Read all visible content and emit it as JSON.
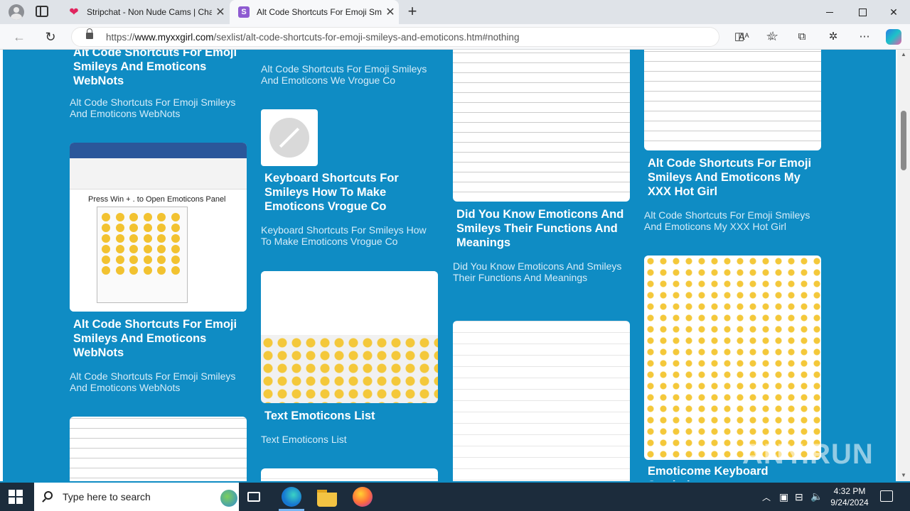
{
  "browser": {
    "tabs": [
      {
        "title": "Stripchat - Non Nude Cams | Cha",
        "active": false
      },
      {
        "title": "Alt Code Shortcuts For Emoji Sm",
        "active": true
      }
    ],
    "url_prefix": "https://",
    "url_domain": "www.myxxgirl.com",
    "url_path": "/sexlist/alt-code-shortcuts-for-emoji-smileys-and-emoticons.htm#nothing",
    "read_aloud_label": "Aᴬ"
  },
  "cards": {
    "c1_top": {
      "title": "Alt Code Shortcuts For Emoji Smileys And Emoticons WebNots",
      "subtitle": "Alt Code Shortcuts For Emoji Smileys And Emoticons WebNots"
    },
    "c1_word": {
      "caption": "Press Win + . to Open Emoticons Panel",
      "title": "Alt Code Shortcuts For Emoji Smileys And Emoticons WebNots",
      "subtitle": "Alt Code Shortcuts For Emoji Smileys And Emoticons WebNots"
    },
    "c2_top": {
      "subtitle": "Alt Code Shortcuts For Emoji Smileys And Emoticons We Vrogue Co"
    },
    "c2_kbd": {
      "title": "Keyboard Shortcuts For Smileys How To Make Emoticons Vrogue Co",
      "subtitle": "Keyboard Shortcuts For Smileys How To Make Emoticons Vrogue Co"
    },
    "c2_text": {
      "title": "Text Emoticons List",
      "subtitle": "Text Emoticons List"
    },
    "c3_dyk": {
      "title": "Did You Know Emoticons And Smileys Their Functions And Meanings",
      "subtitle": "Did You Know Emoticons And Smileys Their Functions And Meanings"
    },
    "c4_xxx": {
      "title": "Alt Code Shortcuts For Emoji Smileys And Emoticons My XXX Hot Girl",
      "subtitle": "Alt Code Shortcuts For Emoji Smileys And Emoticons My XXX Hot Girl"
    },
    "c4_kb": {
      "title": "Emoticome Keyboard Symbols"
    }
  },
  "watermark": "ANY.RUN",
  "taskbar": {
    "search_placeholder": "Type here to search",
    "time": "4:32 PM",
    "date": "9/24/2024"
  }
}
